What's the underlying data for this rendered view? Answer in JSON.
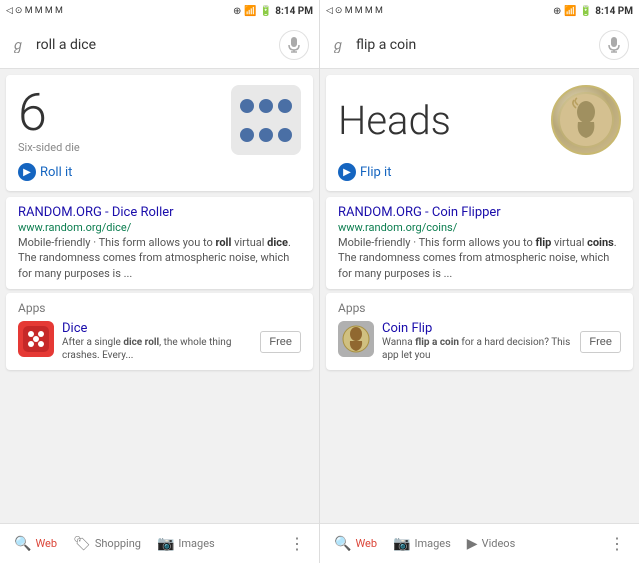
{
  "left": {
    "statusBar": {
      "time": "8:14 PM",
      "icons": "status icons"
    },
    "search": {
      "query": "roll a dice",
      "micLabel": "microphone"
    },
    "diceCard": {
      "number": "6",
      "label": "Six-sided die",
      "rollLabel": "Roll it"
    },
    "webResult": {
      "title": "RANDOM.ORG - Dice Roller",
      "url": "www.random.org/dice/",
      "snippet": "Mobile-friendly · This form allows you to roll virtual dice. The randomness comes from atmospheric noise, which for many purposes is ..."
    },
    "appsSection": {
      "label": "Apps",
      "app": {
        "name": "Dice",
        "description": "After a single dice roll, the whole thing crashes. Every...",
        "freeLabel": "Free"
      }
    },
    "bottomNav": {
      "items": [
        {
          "label": "Web",
          "active": true
        },
        {
          "label": "Shopping",
          "active": false
        },
        {
          "label": "Images",
          "active": false
        }
      ],
      "moreIcon": "⋮"
    }
  },
  "right": {
    "statusBar": {
      "time": "8:14 PM"
    },
    "search": {
      "query": "flip a coin",
      "micLabel": "microphone"
    },
    "coinCard": {
      "result": "Heads",
      "flipLabel": "Flip it"
    },
    "webResult": {
      "title": "RANDOM.ORG - Coin Flipper",
      "url": "www.random.org/coins/",
      "snippet": "Mobile-friendly · This form allows you to flip virtual coins. The randomness comes from atmospheric noise, which for many purposes is ..."
    },
    "appsSection": {
      "label": "Apps",
      "app": {
        "name": "Coin Flip",
        "description": "Wanna flip a coin for a hard decision? This app let you",
        "freeLabel": "Free"
      }
    },
    "bottomNav": {
      "items": [
        {
          "label": "Web",
          "active": true
        },
        {
          "label": "Images",
          "active": false
        },
        {
          "label": "Videos",
          "active": false
        }
      ],
      "moreIcon": "⋮"
    }
  }
}
